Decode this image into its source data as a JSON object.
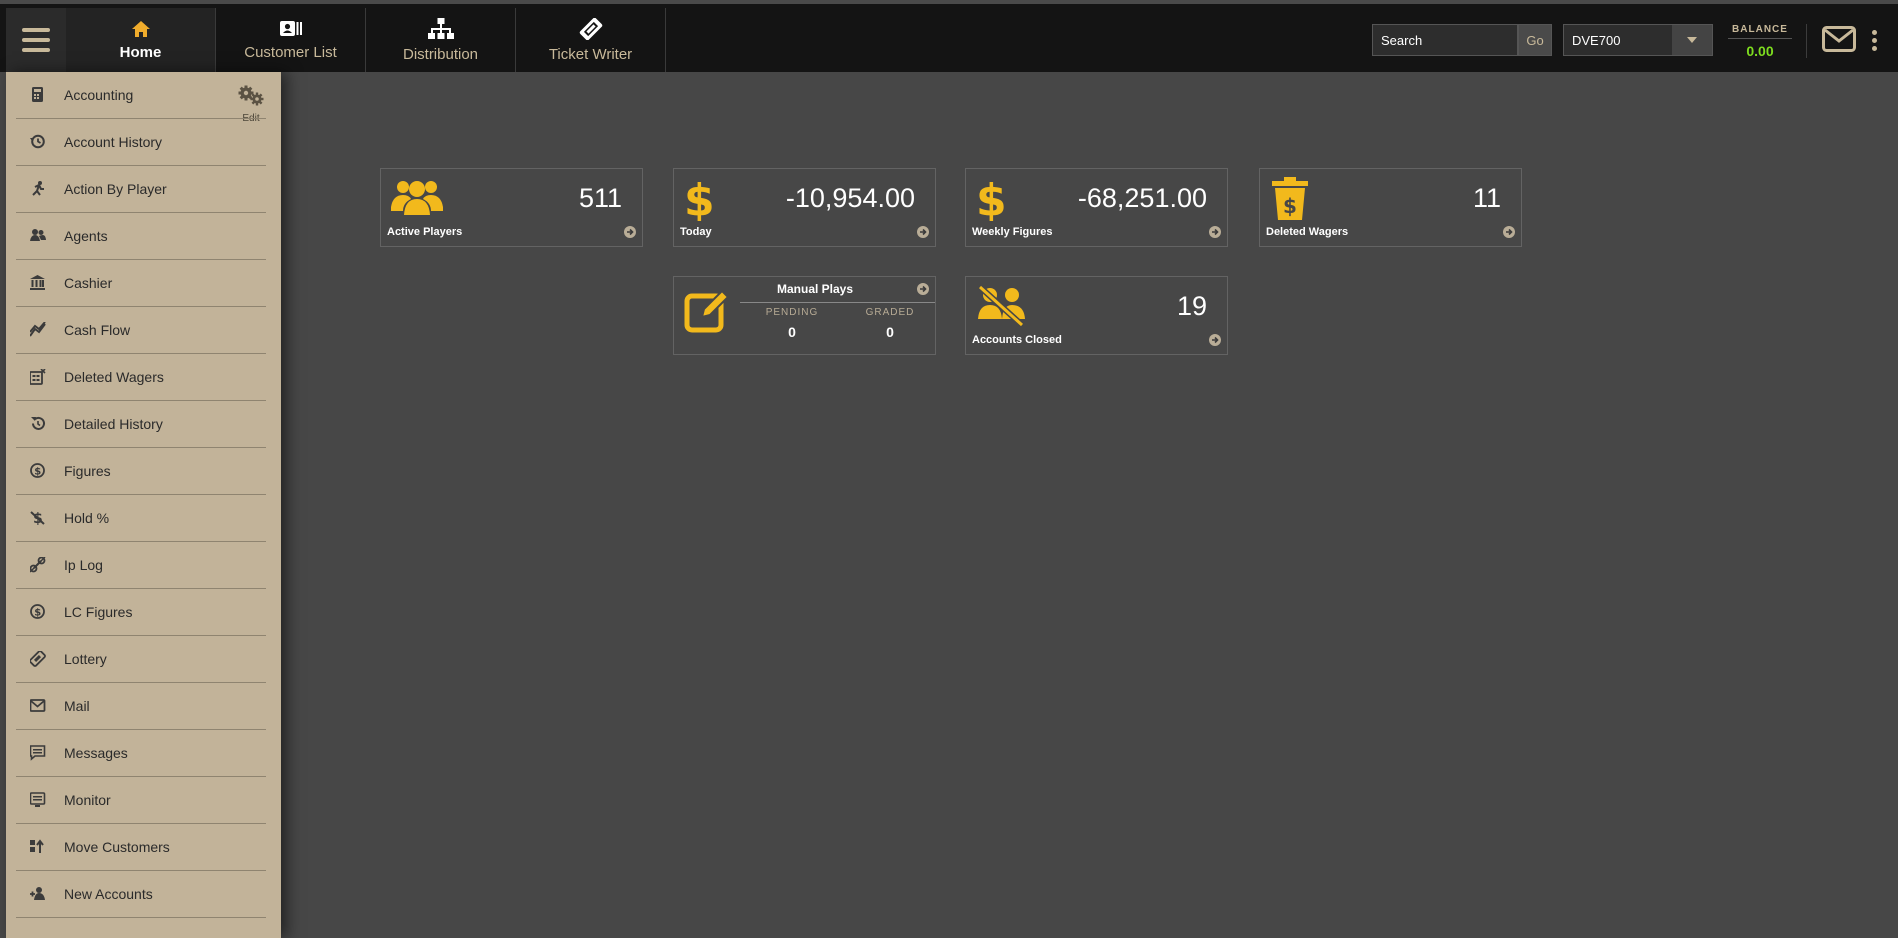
{
  "nav": {
    "home": "Home",
    "customer_list": "Customer List",
    "distribution": "Distribution",
    "ticket_writer": "Ticket Writer"
  },
  "search": {
    "placeholder": "Search",
    "go_label": "Go"
  },
  "account": {
    "selected": "DVE700"
  },
  "balance": {
    "title": "BALANCE",
    "value": "0.00"
  },
  "sidebar": {
    "edit_label": "Edit",
    "items": [
      {
        "label": "Accounting",
        "icon": "calculator-icon"
      },
      {
        "label": "Account History",
        "icon": "history-icon"
      },
      {
        "label": "Action By Player",
        "icon": "running-icon"
      },
      {
        "label": "Agents",
        "icon": "users-icon"
      },
      {
        "label": "Cashier",
        "icon": "bank-icon"
      },
      {
        "label": "Cash Flow",
        "icon": "chart-line-icon"
      },
      {
        "label": "Deleted Wagers",
        "icon": "deleted-list-icon"
      },
      {
        "label": "Detailed History",
        "icon": "undo-icon"
      },
      {
        "label": "Figures",
        "icon": "dollar-circle-icon"
      },
      {
        "label": "Hold %",
        "icon": "dollar-slash-icon"
      },
      {
        "label": "Ip Log",
        "icon": "link-slash-icon"
      },
      {
        "label": "LC Figures",
        "icon": "dollar-circle-icon"
      },
      {
        "label": "Lottery",
        "icon": "ticket-icon"
      },
      {
        "label": "Mail",
        "icon": "envelope-icon"
      },
      {
        "label": "Messages",
        "icon": "message-icon"
      },
      {
        "label": "Monitor",
        "icon": "monitor-icon"
      },
      {
        "label": "Move Customers",
        "icon": "move-icon"
      },
      {
        "label": "New Accounts",
        "icon": "user-plus-icon"
      }
    ]
  },
  "cards": {
    "active_players": {
      "value": "511",
      "label": "Active Players"
    },
    "today": {
      "value": "-10,954.00",
      "label": "Today"
    },
    "weekly": {
      "value": "-68,251.00",
      "label": "Weekly Figures"
    },
    "deleted": {
      "value": "11",
      "label": "Deleted Wagers"
    },
    "manual_plays": {
      "title": "Manual Plays",
      "pending_label": "PENDING",
      "pending_value": "0",
      "graded_label": "GRADED",
      "graded_value": "0"
    },
    "accounts_closed": {
      "value": "19",
      "label": "Accounts Closed"
    }
  },
  "colors": {
    "accent": "#f2b91c",
    "sidebar_bg": "#c2b399",
    "balance": "#7ddc1f"
  }
}
